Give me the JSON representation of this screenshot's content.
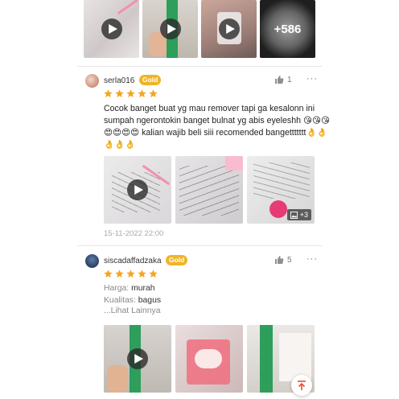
{
  "top_gallery": {
    "more_label": "+586"
  },
  "reviews": [
    {
      "username": "serla016",
      "badge": "Gold",
      "rating": 5,
      "likes": "1",
      "menu": "···",
      "text": "Cocok banget buat yg mau remover tapi ga kesalonn ini sumpah ngerontokin banget bulnat yg abis eyeleshh 😘😘😘😍😍😍😍 kalian wajib beli siii recomended bangettttttt👌👌👌👌👌",
      "media_more": "+3",
      "timestamp": "15-11-2022 22:00"
    },
    {
      "username": "siscadaffadzaka",
      "badge": "Gold",
      "rating": 5,
      "likes": "5",
      "menu": "···",
      "details": [
        {
          "key": "Harga:",
          "value": "murah"
        },
        {
          "key": "Kualitas:",
          "value": "bagus"
        }
      ],
      "see_more": "...Lihat Lainnya"
    }
  ],
  "icons": {
    "play": "play-icon",
    "like": "thumbs-up-icon",
    "star": "star-icon",
    "image": "image-icon",
    "scroll_top": "arrow-up-icon"
  },
  "colors": {
    "star": "#f5a623",
    "badge": "#f0b429",
    "scroll_top_arrow": "#ee4d2d"
  }
}
